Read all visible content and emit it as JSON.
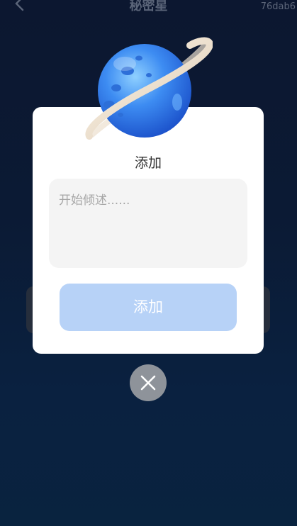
{
  "header": {
    "title": "秘密星",
    "code": "76dab6"
  },
  "dialog": {
    "title": "添加",
    "input": {
      "placeholder": "开始倾述......",
      "value": ""
    },
    "button_label": "添加"
  },
  "colors": {
    "button_bg": "#b7d2f7",
    "dialog_bg": "#ffffff",
    "page_bg": "#0b1a34",
    "close_bg": "#8e939a"
  },
  "icons": [
    "back-icon",
    "planet-icon",
    "close-icon"
  ]
}
